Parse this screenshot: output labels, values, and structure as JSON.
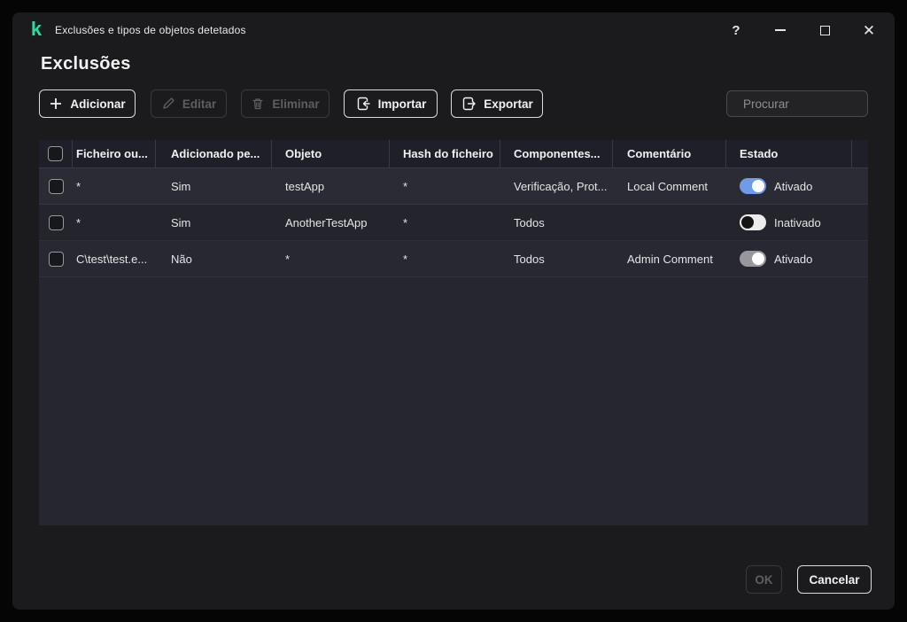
{
  "window": {
    "title": "Exclusões e tipos de objetos detetados",
    "controls": {
      "help": "?",
      "close": "✕"
    }
  },
  "page": {
    "title": "Exclusões"
  },
  "toolbar": {
    "buttons": [
      {
        "label": "Adicionar",
        "icon": "plus-icon",
        "enabled": true
      },
      {
        "label": "Editar",
        "icon": "pencil-icon",
        "enabled": false
      },
      {
        "label": "Eliminar",
        "icon": "trash-icon",
        "enabled": false
      },
      {
        "label": "Importar",
        "icon": "import-icon",
        "enabled": true
      },
      {
        "label": "Exportar",
        "icon": "export-icon",
        "enabled": true
      }
    ],
    "search": {
      "placeholder": "Procurar",
      "value": ""
    }
  },
  "table": {
    "columns": [
      "Ficheiro ou...",
      "Adicionado pe...",
      "Objeto",
      "Hash do ficheiro",
      "Componentes...",
      "Comentário",
      "Estado"
    ],
    "rows": [
      {
        "file": "*",
        "added_by": "Sim",
        "object": "testApp",
        "hash": "*",
        "components": "Verificação, Prot...",
        "comment": "Local Comment",
        "state": {
          "label": "Ativado",
          "toggle": "on-blue"
        }
      },
      {
        "file": "*",
        "added_by": "Sim",
        "object": "AnotherTestApp",
        "hash": "*",
        "components": "Todos",
        "comment": "",
        "state": {
          "label": "Inativado",
          "toggle": "off"
        }
      },
      {
        "file": "C\\test\\test.e...",
        "added_by": "Não",
        "object": "*",
        "hash": "*",
        "components": "Todos",
        "comment": "Admin Comment",
        "state": {
          "label": "Ativado",
          "toggle": "on-gray"
        }
      }
    ]
  },
  "footer": {
    "ok": "OK",
    "cancel": "Cancelar"
  },
  "colors": {
    "brand_teal": "#2bd9a5",
    "toggle_on_blue": "#6f9be8",
    "toggle_on_gray": "#98979d",
    "panel_bg": "#26262f",
    "window_bg": "#1b1b1d"
  }
}
